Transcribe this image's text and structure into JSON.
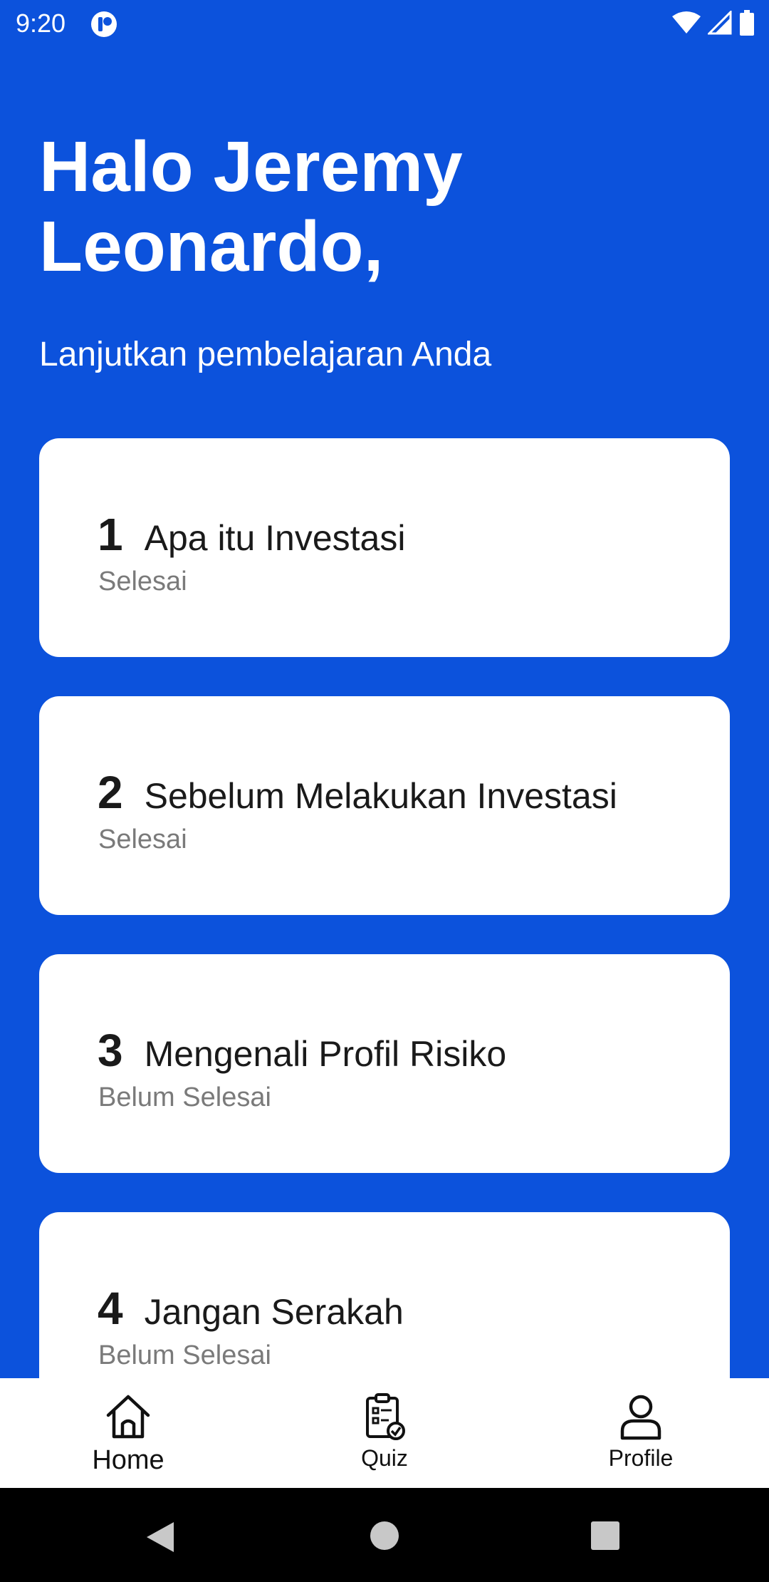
{
  "colors": {
    "background": "#0c52dc",
    "card": "#ffffff",
    "text_primary": "#1a1a1a",
    "text_secondary": "#7a7a7a"
  },
  "status_bar": {
    "time": "9:20",
    "icons": [
      "app-notification-icon",
      "wifi-icon",
      "signal-icon",
      "battery-icon"
    ]
  },
  "greeting": {
    "line1": "Halo Jeremy",
    "line2": "Leonardo,"
  },
  "subtitle": "Lanjutkan pembelajaran Anda",
  "lessons": [
    {
      "number": "1",
      "title": "Apa itu Investasi",
      "status": "Selesai"
    },
    {
      "number": "2",
      "title": "Sebelum Melakukan Investasi",
      "status": "Selesai"
    },
    {
      "number": "3",
      "title": "Mengenali Profil Risiko",
      "status": "Belum Selesai"
    },
    {
      "number": "4",
      "title": "Jangan Serakah",
      "status": "Belum Selesai"
    }
  ],
  "bottom_nav": {
    "items": [
      {
        "label": "Home",
        "icon": "home-icon",
        "active": true
      },
      {
        "label": "Quiz",
        "icon": "clipboard-check-icon",
        "active": false
      },
      {
        "label": "Profile",
        "icon": "person-icon",
        "active": false
      }
    ]
  },
  "system_nav": {
    "icons": [
      "back-icon",
      "home-circle-icon",
      "recents-icon"
    ]
  }
}
